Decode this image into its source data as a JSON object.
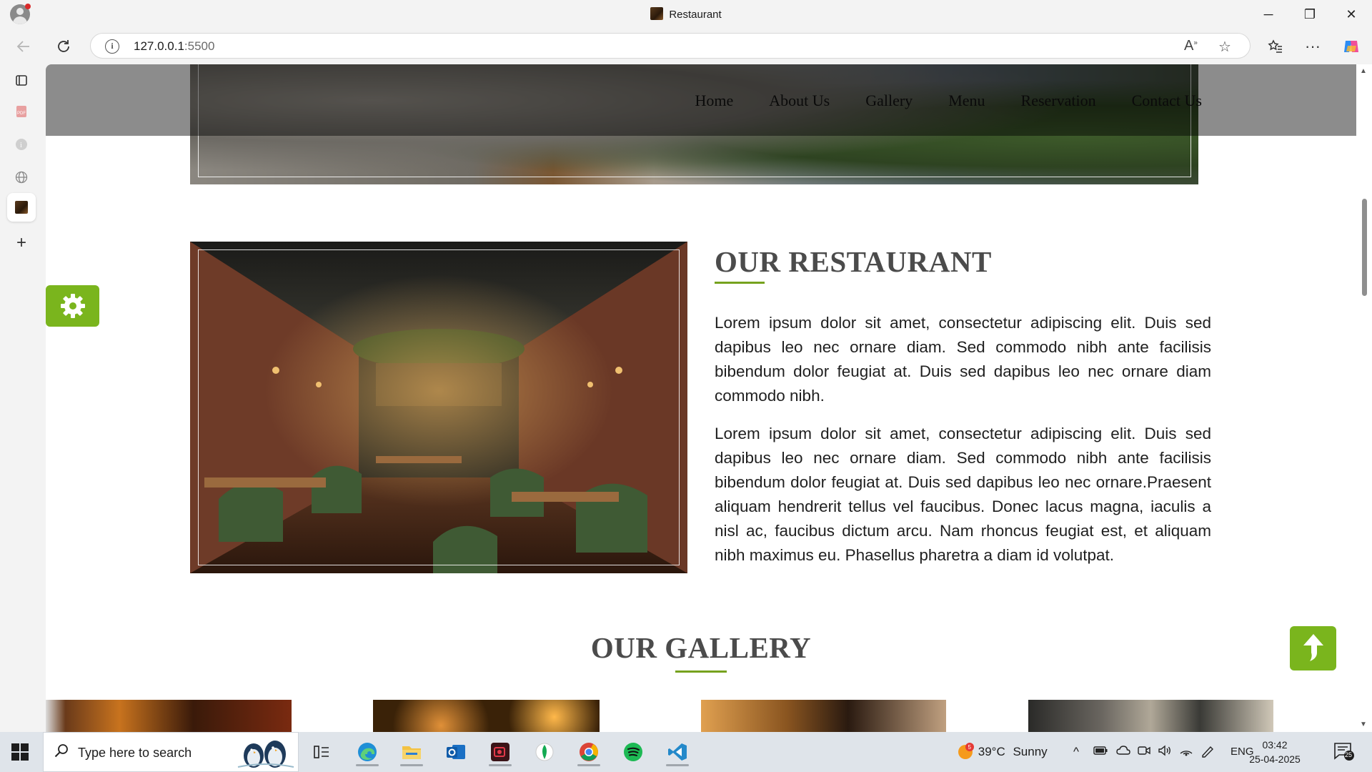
{
  "browser": {
    "tab_title": "Restaurant",
    "url_host": "127.0.0.1",
    "url_port": ":5500",
    "window_controls": {
      "minimize": "─",
      "restore": "❐",
      "close": "✕"
    }
  },
  "nav": {
    "items": [
      "Home",
      "About Us",
      "Gallery",
      "Menu",
      "Reservation",
      "Contact Us"
    ]
  },
  "about": {
    "title": "OUR RESTAURANT",
    "paragraphs": [
      "Lorem ipsum dolor sit amet, consectetur adipiscing elit. Duis sed dapibus leo nec ornare diam. Sed commodo nibh ante facilisis bibendum dolor feugiat at. Duis sed dapibus leo nec ornare diam commodo nibh.",
      "Lorem ipsum dolor sit amet, consectetur adipiscing elit. Duis sed dapibus leo nec ornare diam. Sed commodo nibh ante facilisis bibendum dolor feugiat at. Duis sed dapibus leo nec ornare.Praesent aliquam hendrerit tellus vel faucibus. Donec lacus magna, iaculis a nisl ac, faucibus dictum arcu. Nam rhoncus feugiat est, et aliquam nibh maximus eu. Phasellus pharetra a diam id volutpat."
    ]
  },
  "gallery": {
    "title": "OUR GALLERY"
  },
  "colors": {
    "accent": "#7ab51d",
    "title_underline": "#76a21e",
    "heading": "#4b4b4b"
  },
  "taskbar": {
    "search_placeholder": "Type here to search",
    "weather": {
      "temp": "39°C",
      "condition": "Sunny",
      "badge": "5"
    },
    "language": "ENG",
    "time": "03:42",
    "date": "25-04-2025",
    "notifications": "25",
    "apps": [
      "task-view",
      "edge",
      "file-explorer",
      "outlook",
      "screen-recorder",
      "mongodb-compass",
      "chrome",
      "spotify",
      "vscode"
    ]
  }
}
